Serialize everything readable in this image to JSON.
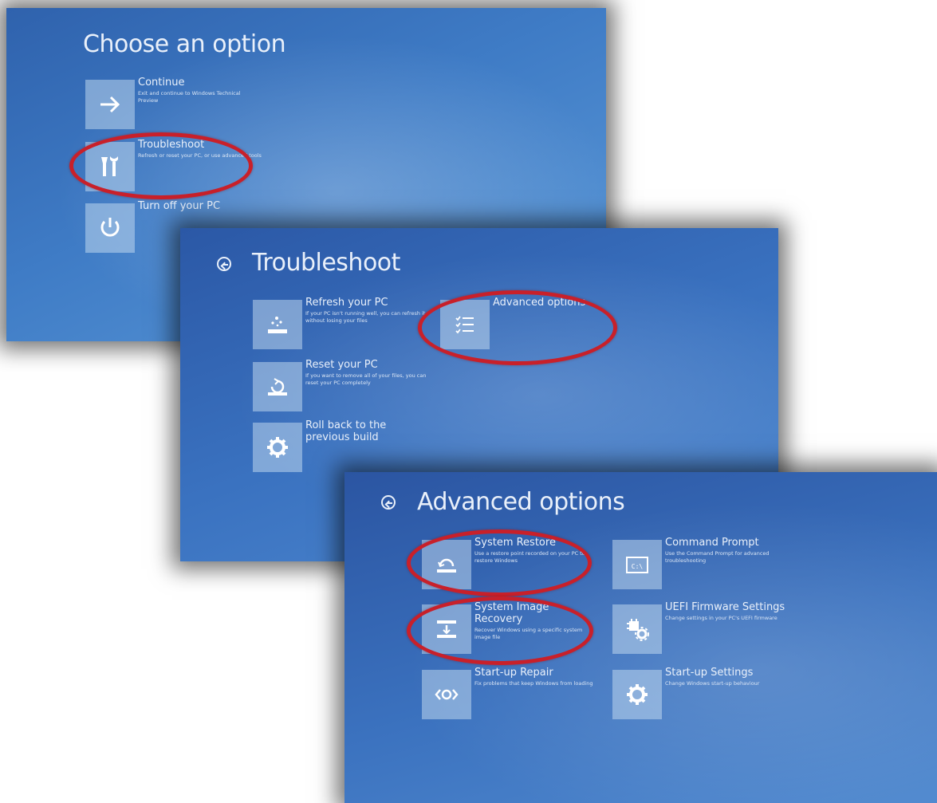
{
  "choose": {
    "title": "Choose an option",
    "options": [
      {
        "title": "Continue",
        "desc": "Exit and continue to Windows Technical Preview",
        "icon": "arrow-right-icon"
      },
      {
        "title": "Troubleshoot",
        "desc": "Refresh or reset your PC, or use advanced tools",
        "icon": "tools-icon"
      },
      {
        "title": "Turn off your PC",
        "desc": "",
        "icon": "power-icon"
      }
    ]
  },
  "troubleshoot": {
    "title": "Troubleshoot",
    "options": [
      {
        "title": "Refresh your PC",
        "desc": "If your PC isn't running well, you can refresh it without losing your files",
        "icon": "refresh-pc-icon"
      },
      {
        "title": "Reset your PC",
        "desc": "If you want to remove all of your files, you can reset your PC completely",
        "icon": "reset-pc-icon"
      },
      {
        "title": "Roll back to the previous build",
        "desc": "",
        "icon": "gear-icon"
      },
      {
        "title": "Advanced options",
        "desc": "",
        "icon": "checklist-icon"
      }
    ]
  },
  "advanced": {
    "title": "Advanced options",
    "options": [
      {
        "title": "System Restore",
        "desc": "Use a restore point recorded on your PC to restore Windows",
        "icon": "system-restore-icon"
      },
      {
        "title": "System Image Recovery",
        "desc": "Recover Windows using a specific system image file",
        "icon": "image-recovery-icon"
      },
      {
        "title": "Start-up Repair",
        "desc": "Fix problems that keep Windows from loading",
        "icon": "startup-repair-icon"
      },
      {
        "title": "Command Prompt",
        "desc": "Use the Command Prompt for advanced troubleshooting",
        "icon": "command-prompt-icon"
      },
      {
        "title": "UEFI Firmware Settings",
        "desc": "Change settings in your PC's UEFI firmware",
        "icon": "uefi-firmware-icon"
      },
      {
        "title": "Start-up Settings",
        "desc": "Change Windows start-up behaviour",
        "icon": "gear-icon"
      }
    ]
  },
  "highlight_color": "#c8202a",
  "tile_color": "#c3daf0"
}
